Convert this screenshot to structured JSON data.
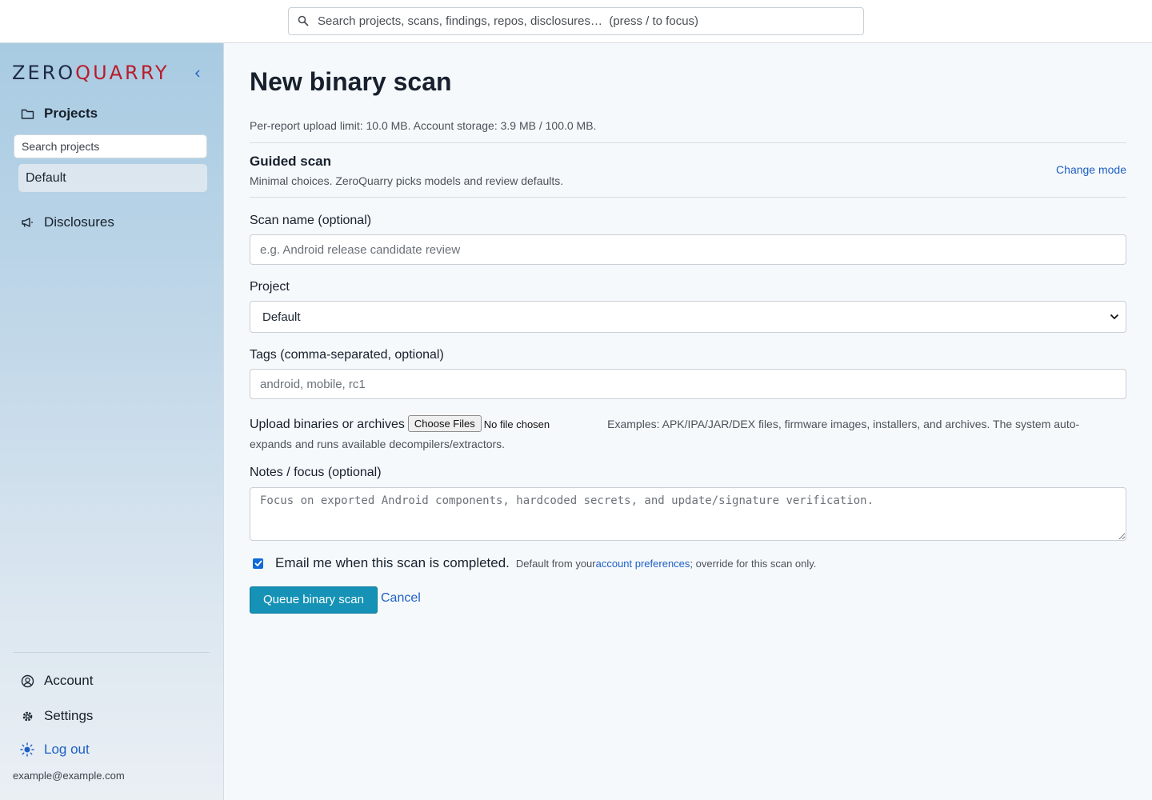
{
  "global_search": {
    "placeholder": "Search projects, scans, findings, repos, disclosures…  (press / to focus)"
  },
  "sidebar": {
    "logo": {
      "zero": "ZΕRO",
      "quarry": "QUARRY",
      "zero_color": "#1f2a4a",
      "quarry_color": "#b91c2b"
    },
    "collapse_icon": "chevron-left-icon",
    "projects_label": "Projects",
    "project_search_placeholder": "Search projects",
    "projects": [
      "Default"
    ],
    "disclosures_label": "Disclosures",
    "account_label": "Account",
    "settings_label": "Settings",
    "logout_label": "Log out",
    "user_email": "example@example.com"
  },
  "main": {
    "title": "New binary scan",
    "limits": "Per-report upload limit: 10.0 MB. Account storage: 3.9 MB / 100.0 MB.",
    "mode_title": "Guided scan",
    "mode_desc": "Minimal choices. ZeroQuarry picks models and review defaults.",
    "change_mode": "Change mode",
    "scan_name_label": "Scan name (optional)",
    "scan_name_placeholder": "e.g. Android release candidate review",
    "project_label": "Project",
    "project_selected": "Default",
    "tags_label": "Tags (comma-separated, optional)",
    "tags_placeholder": "android, mobile, rc1",
    "upload_label": "Upload binaries or archives",
    "upload_button": "Choose Files",
    "upload_status": "No file chosen",
    "upload_hint": "Examples: APK/IPA/JAR/DEX files, firmware images, installers, and archives. The system auto-expands and runs available decompilers/extractors.",
    "notes_label": "Notes / focus (optional)",
    "notes_placeholder": "Focus on exported Android components, hardcoded secrets, and update/signature verification.",
    "email_checked": true,
    "email_label": "Email me when this scan is completed.",
    "email_hint_prefix": "Default from your ",
    "email_hint_link": "account preferences",
    "email_hint_suffix": "; override for this scan only.",
    "queue_button": "Queue binary scan",
    "cancel_link": "Cancel"
  },
  "colors": {
    "accent_button": "#1592b6",
    "link": "#1d5fc4",
    "checkbox": "#0f6ad8"
  }
}
